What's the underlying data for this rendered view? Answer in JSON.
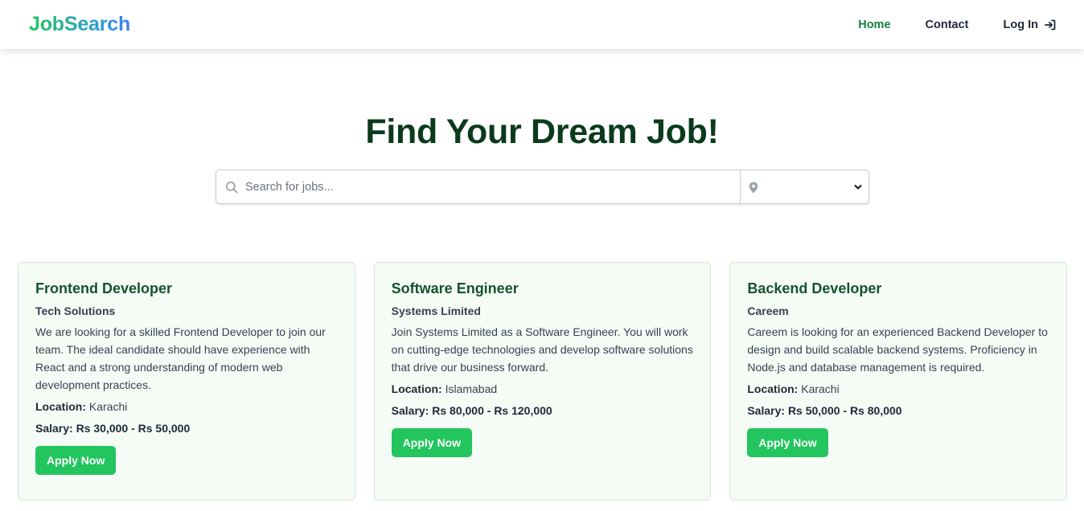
{
  "header": {
    "brand": "JobSearch",
    "nav": [
      {
        "label": "Home",
        "active": true
      },
      {
        "label": "Contact",
        "active": false
      },
      {
        "label": "Log In",
        "active": false
      }
    ],
    "login_icon": "sign-in-icon"
  },
  "hero": {
    "title": "Find Your Dream Job!",
    "search_placeholder": "Search for jobs...",
    "location_value": ""
  },
  "jobs": [
    {
      "title": "Frontend Developer",
      "company": "Tech Solutions",
      "description": "We are looking for a skilled Frontend Developer to join our team. The ideal candidate should have experience with React and a strong understanding of modern web development practices.",
      "location_label": "Location:",
      "location": "Karachi",
      "salary_label": "Salary:",
      "salary": "Rs 30,000 - Rs 50,000",
      "button": "Apply Now"
    },
    {
      "title": "Software Engineer",
      "company": "Systems Limited",
      "description": "Join Systems Limited as a Software Engineer. You will work on cutting-edge technologies and develop software solutions that drive our business forward.",
      "location_label": "Location:",
      "location": "Islamabad",
      "salary_label": "Salary:",
      "salary": "Rs 80,000 - Rs 120,000",
      "button": "Apply Now"
    },
    {
      "title": "Backend Developer",
      "company": "Careem",
      "description": "Careem is looking for an experienced Backend Developer to design and build scalable backend systems. Proficiency in Node.js and database management is required.",
      "location_label": "Location:",
      "location": "Karachi",
      "salary_label": "Salary:",
      "salary": "Rs 50,000 - Rs 80,000",
      "button": "Apply Now"
    }
  ],
  "colors": {
    "brand_green": "#22c55e",
    "brand_blue": "#3b82f6",
    "active_nav": "#15803d",
    "title_dark_green": "#0b3a1c",
    "card_title_green": "#14532d",
    "card_bg": "#f5fcf6",
    "button_green": "#22c55e"
  }
}
